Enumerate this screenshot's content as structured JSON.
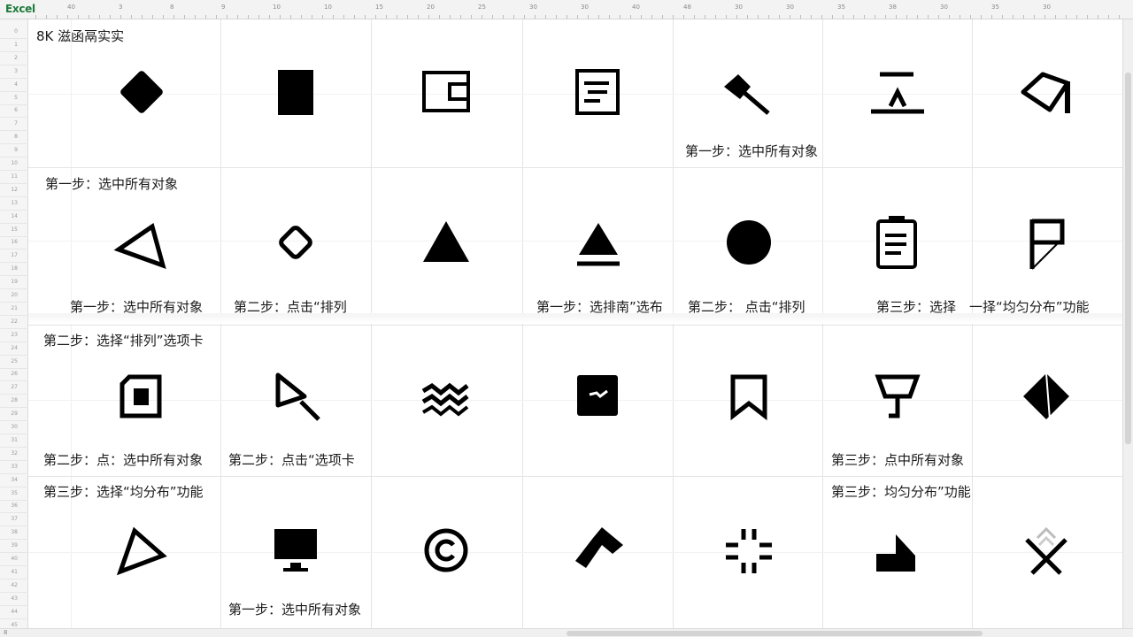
{
  "app": {
    "logo": "Excel",
    "sheet_title": "8K 滋函鬲实实",
    "sheet_tab": "8"
  },
  "ruler_top": [
    "40",
    "3",
    "8",
    "9",
    "10",
    "10",
    "15",
    "20",
    "25",
    "30",
    "30",
    "40",
    "48",
    "30",
    "30",
    "35",
    "38",
    "30",
    "35",
    "30"
  ],
  "row_numbers": [
    "0",
    "1",
    "2",
    "3",
    "4",
    "5",
    "6",
    "7",
    "8",
    "9",
    "10",
    "11",
    "12",
    "13",
    "14",
    "15",
    "16",
    "17",
    "18",
    "19",
    "20",
    "21",
    "22",
    "23",
    "24",
    "25",
    "26",
    "27",
    "28",
    "29",
    "30",
    "31",
    "32",
    "33",
    "34",
    "35",
    "36",
    "37",
    "38",
    "39",
    "40",
    "41",
    "42",
    "43",
    "44",
    "45"
  ],
  "labels": {
    "r1_e": "第一步：选中所有对象",
    "r2_head": "第一步：选中所有对象",
    "r2_a": "第一步：选中所有对象",
    "r2_b": "第二步：点击“排列",
    "r2_d": "第一步：选排南”选布",
    "r2_e": "第二步： 点击“排列",
    "r2_f": "第三步：选择　一择“均匀分布”功能",
    "r3_head": "第二步：选择“排列”选项卡",
    "r3_a": "第二步：点：选中所有对象",
    "r3_b": "第二步：点击“选项卡",
    "r3_f": "第三步：点中所有对象",
    "r4_head": "第三步：选择“均分布”功能",
    "r4_f": "第三步：均匀分布”功能",
    "r4_b": "第一步：选中所有对象"
  },
  "icons": [
    "diamond-filled-icon",
    "rectangle-filled-icon",
    "wallet-outline-icon",
    "note-lines-icon",
    "hammer-icon",
    "line-base-icon",
    "diamond-arrow-outline-icon",
    "triangle-outline-icon",
    "rounded-diamond-outline-icon",
    "triangle-filled-icon",
    "cone-base-icon",
    "circle-filled-icon",
    "clipboard-list-icon",
    "flag-outline-icon",
    "square-nested-icon",
    "magnifier-triangle-icon",
    "wave-stack-icon",
    "square-wave-icon",
    "bookmark-outline-icon",
    "goblet-icon",
    "diamond-split-icon",
    "triangle-outline-small-icon",
    "monitor-icon",
    "copyright-circle-icon",
    "hammer-filled-icon",
    "hash-grid-icon",
    "step-shape-icon",
    "cross-x-icon"
  ]
}
